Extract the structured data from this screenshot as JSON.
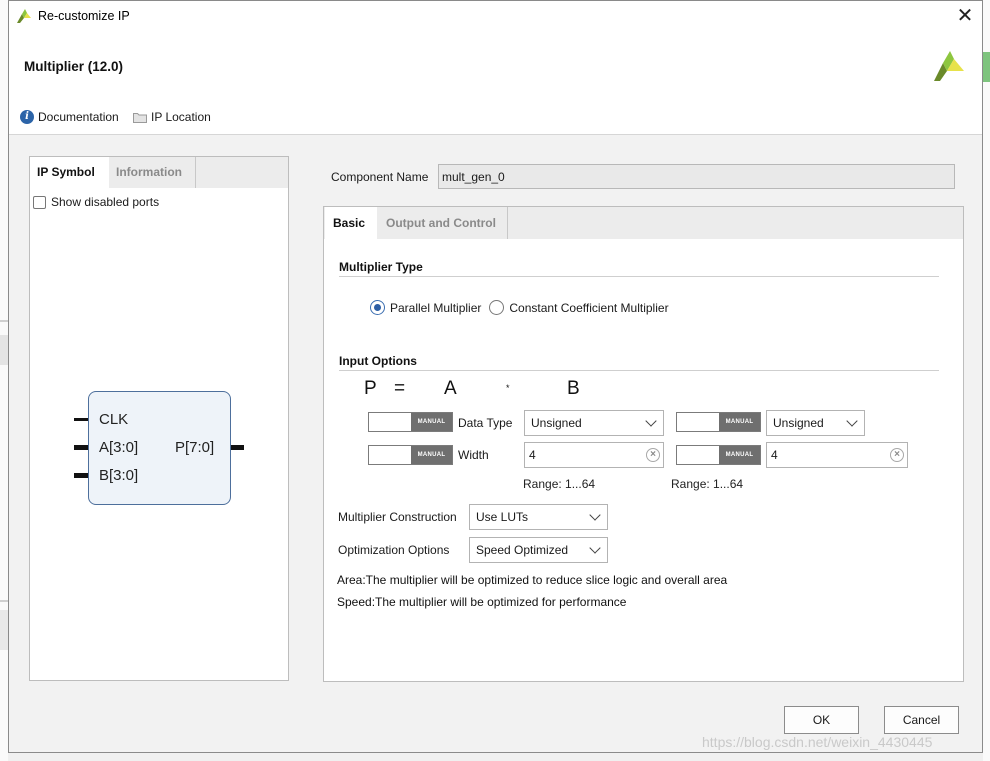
{
  "window": {
    "title": "Re-customize IP",
    "close_glyph": "✕"
  },
  "header": {
    "ip_title": "Multiplier (12.0)",
    "documentation_label": "Documentation",
    "ip_location_label": "IP Location"
  },
  "left_panel": {
    "tabs": [
      {
        "label": "IP Symbol",
        "active": true
      },
      {
        "label": "Information",
        "active": false
      }
    ],
    "show_disabled_ports_label": "Show disabled ports",
    "show_disabled_ports_checked": false,
    "symbol": {
      "ports_in": [
        "CLK",
        "A[3:0]",
        "B[3:0]"
      ],
      "ports_out": [
        "P[7:0]"
      ]
    }
  },
  "component": {
    "label": "Component Name",
    "value": "mult_gen_0"
  },
  "right_tabs": [
    {
      "label": "Basic",
      "active": true
    },
    {
      "label": "Output and Control",
      "active": false
    }
  ],
  "basic": {
    "multiplier_type": {
      "title": "Multiplier Type",
      "options": [
        {
          "label": "Parallel Multiplier",
          "checked": true
        },
        {
          "label": "Constant Coefficient Multiplier",
          "checked": false
        }
      ]
    },
    "input_options": {
      "title": "Input Options",
      "formula": {
        "p": "P",
        "eq": "=",
        "a": "A",
        "op": "*",
        "b": "B"
      },
      "manual_label": "MANUAL",
      "data_type_label": "Data Type",
      "width_label": "Width",
      "a_data_type": "Unsigned",
      "b_data_type": "Unsigned",
      "a_width": "4",
      "b_width": "4",
      "a_range": "Range: 1...64",
      "b_range": "Range: 1...64"
    },
    "construction": {
      "label": "Multiplier Construction",
      "value": "Use LUTs"
    },
    "optimization": {
      "label": "Optimization Options",
      "value": "Speed Optimized"
    },
    "descriptions": [
      "Area:The multiplier will be optimized to reduce slice logic and overall area",
      "Speed:The multiplier will be optimized for performance"
    ]
  },
  "buttons": {
    "ok": "OK",
    "cancel": "Cancel"
  },
  "watermark": "https://blog.csdn.net/weixin_4430445",
  "colors": {
    "brand_green": "#8dc63f",
    "brand_yellow": "#e7e24a",
    "radio_blue": "#2c5ea5",
    "info_blue": "#2c64a8"
  }
}
